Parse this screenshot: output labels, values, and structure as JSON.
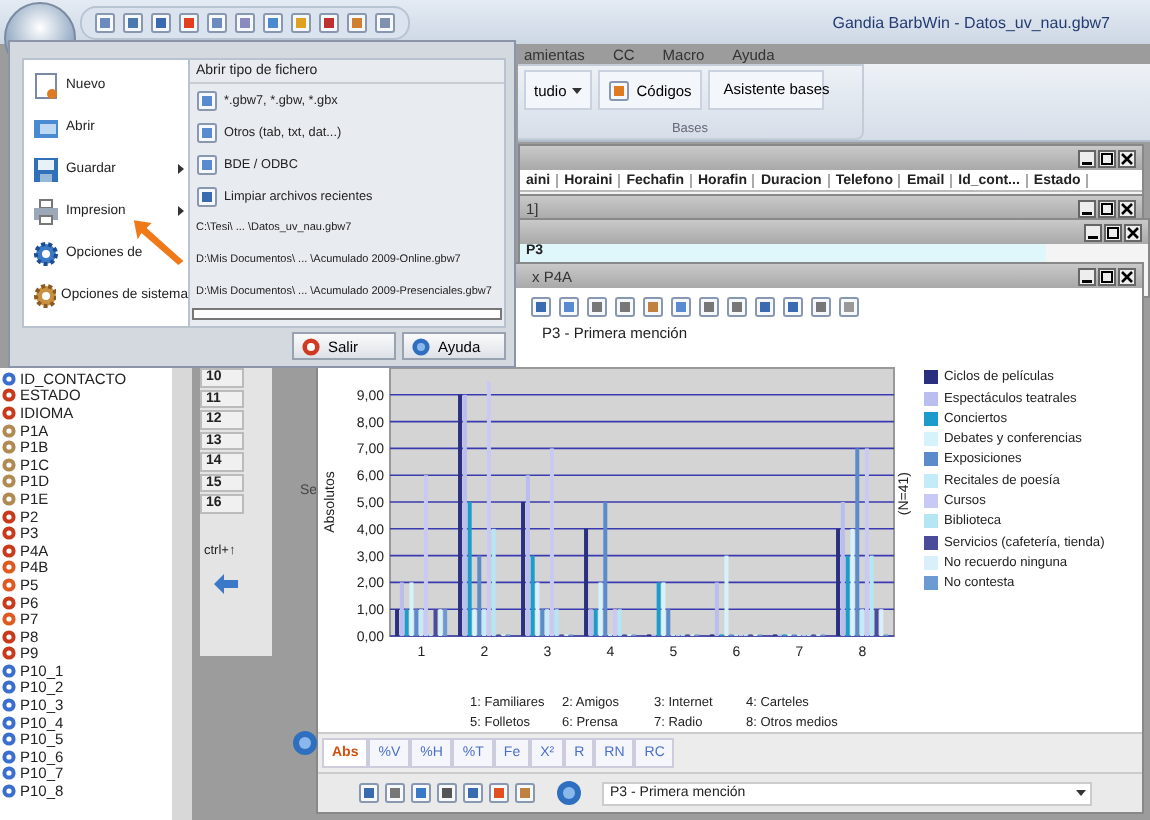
{
  "title_bar": {
    "title": "Gandia BarbWin - Datos_uv_nau.gbw7"
  },
  "menu_tabs": [
    {
      "label": "amientas",
      "selected": false
    },
    {
      "label": "CC",
      "selected": false
    },
    {
      "label": "Macro",
      "selected": false
    },
    {
      "label": "Ayuda",
      "selected": false
    }
  ],
  "ribbon": {
    "buttons": [
      {
        "label": "tudio",
        "kind": "dropdown"
      },
      {
        "label": "Códigos",
        "kind": "small"
      },
      {
        "label": "Asistente bases",
        "kind": "large"
      }
    ],
    "group_label": "Bases"
  },
  "variables": [
    {
      "name": "ID_CONTACTO",
      "kind": "numeric"
    },
    {
      "name": "ESTADO",
      "kind": "categorical"
    },
    {
      "name": "IDIOMA",
      "kind": "categorical"
    },
    {
      "name": "P1A",
      "kind": "alpha"
    },
    {
      "name": "P1B",
      "kind": "alpha"
    },
    {
      "name": "P1C",
      "kind": "alpha"
    },
    {
      "name": "P1D",
      "kind": "alpha"
    },
    {
      "name": "P1E",
      "kind": "alpha"
    },
    {
      "name": "P2",
      "kind": "categorical"
    },
    {
      "name": "P3",
      "kind": "categorical"
    },
    {
      "name": "P4A",
      "kind": "categorical"
    },
    {
      "name": "P4B",
      "kind": "multiple"
    },
    {
      "name": "P5",
      "kind": "multiple"
    },
    {
      "name": "P6",
      "kind": "categorical"
    },
    {
      "name": "P7",
      "kind": "multiple"
    },
    {
      "name": "P8",
      "kind": "categorical"
    },
    {
      "name": "P9",
      "kind": "categorical"
    },
    {
      "name": "P10_1",
      "kind": "numeric"
    },
    {
      "name": "P10_2",
      "kind": "numeric"
    },
    {
      "name": "P10_3",
      "kind": "numeric"
    },
    {
      "name": "P10_4",
      "kind": "numeric"
    },
    {
      "name": "P10_5",
      "kind": "numeric"
    },
    {
      "name": "P10_6",
      "kind": "numeric"
    },
    {
      "name": "P10_7",
      "kind": "numeric"
    },
    {
      "name": "P10_8",
      "kind": "numeric"
    }
  ],
  "row_panel": {
    "rows": [
      "10",
      "11",
      "12",
      "13",
      "14",
      "15",
      "16"
    ],
    "shortcut": "ctrl+↑",
    "cut_text": "Se"
  },
  "data_window": {
    "columns": [
      "aini",
      "Horaini",
      "Fechafin",
      "Horafin",
      "Duracion",
      "Telefono",
      "Email",
      "Id_cont...",
      "Estado"
    ]
  },
  "back_windows": [
    {
      "title": "1]"
    },
    {
      "title": "P3"
    }
  ],
  "chart_window": {
    "title": "x P4A",
    "chart_title": "P3 - Primera mención",
    "n_label": "(N=41)",
    "category_legend": [
      "1:  Familiares",
      "2:  Amigos",
      "3:  Internet",
      "4:  Carteles",
      "5:  Folletos",
      "6:  Prensa",
      "7:  Radio",
      "8:  Otros medios"
    ],
    "tabs": [
      {
        "label": "Abs",
        "selected": true
      },
      {
        "label": "%V",
        "selected": false
      },
      {
        "label": "%H",
        "selected": false
      },
      {
        "label": "%T",
        "selected": false
      },
      {
        "label": "Fe",
        "selected": false
      },
      {
        "label": "X²",
        "selected": false
      },
      {
        "label": "R",
        "selected": false
      },
      {
        "label": "RN",
        "selected": false
      },
      {
        "label": "RC",
        "selected": false
      }
    ],
    "selector": "P3 - Primera mención",
    "chart_data": {
      "type": "bar",
      "grid": true,
      "ylabel": "Absolutos",
      "categories": [
        "1",
        "2",
        "3",
        "4",
        "5",
        "6",
        "7",
        "8"
      ],
      "ylim": [
        0,
        10
      ],
      "yticks": [
        {
          "value": 0,
          "label": "0,00"
        },
        {
          "value": 1,
          "label": "1,00"
        },
        {
          "value": 2,
          "label": "2,00"
        },
        {
          "value": 3,
          "label": "3,00"
        },
        {
          "value": 4,
          "label": "4,00"
        },
        {
          "value": 5,
          "label": "5,00"
        },
        {
          "value": 6,
          "label": "6,00"
        },
        {
          "value": 7,
          "label": "7,00"
        },
        {
          "value": 8,
          "label": "8,00"
        },
        {
          "value": 9,
          "label": "9,00"
        }
      ],
      "series": [
        {
          "name": "Ciclos de películas",
          "color": "#2b2f80",
          "values": [
            1,
            9,
            5,
            4,
            0,
            0,
            0,
            4
          ]
        },
        {
          "name": "Espectáculos teatrales",
          "color": "#b9bdf0",
          "values": [
            2,
            9,
            6,
            1,
            0,
            2,
            0,
            5
          ]
        },
        {
          "name": "Conciertos",
          "color": "#1c9ccb",
          "values": [
            1,
            5,
            3,
            1,
            2,
            0,
            0,
            3
          ]
        },
        {
          "name": "Debates y conferencias",
          "color": "#d6f3fb",
          "values": [
            2,
            1,
            2,
            2,
            2,
            3,
            0,
            4
          ]
        },
        {
          "name": "Exposiciones",
          "color": "#5b8bcb",
          "values": [
            1,
            3,
            1,
            5,
            1,
            0,
            0,
            7
          ]
        },
        {
          "name": "Recitales de poesía",
          "color": "#c6ebf8",
          "values": [
            1,
            1,
            1,
            0,
            0,
            0,
            0,
            1
          ]
        },
        {
          "name": "Cursos",
          "color": "#c9c9f5",
          "values": [
            6,
            9.5,
            7,
            1,
            0,
            0,
            0,
            7
          ]
        },
        {
          "name": "Biblioteca",
          "color": "#b5e6f4",
          "values": [
            0,
            4,
            1,
            1,
            0,
            0,
            0,
            3
          ]
        },
        {
          "name": "Servicios (cafetería, tienda)",
          "color": "#4b4b9c",
          "values": [
            1,
            0,
            0,
            0,
            0,
            0,
            0,
            1
          ]
        },
        {
          "name": "No recuerdo ninguna",
          "color": "#d9f0fa",
          "values": [
            1,
            0,
            0,
            0,
            0,
            0,
            0,
            1
          ]
        },
        {
          "name": "No contesta",
          "color": "#6b9bd1",
          "values": [
            1,
            0,
            0,
            0,
            0,
            0,
            0,
            0
          ]
        }
      ]
    }
  },
  "app_menu": {
    "items": [
      {
        "label": "Nuevo",
        "submenu": false
      },
      {
        "label": "Abrir",
        "submenu": false
      },
      {
        "label": "Guardar",
        "submenu": true
      },
      {
        "label": "Impresion",
        "submenu": true
      },
      {
        "label": "Opciones de",
        "submenu": false
      },
      {
        "label": "Opciones de sistema",
        "submenu": false
      }
    ],
    "header": "Abrir tipo de fichero",
    "open_items": [
      "*.gbw7, *.gbw, *.gbx",
      "Otros (tab, txt, dat...)",
      "BDE / ODBC",
      "Limpiar archivos recientes"
    ],
    "recent_files": [
      "C:\\Tesi\\ ... \\Datos_uv_nau.gbw7",
      "D:\\Mis Documentos\\ ... \\Acumulado 2009-Online.gbw7",
      "D:\\Mis Documentos\\ ... \\Acumulado 2009-Presenciales.gbw7"
    ],
    "buttons": [
      "Salir",
      "Ayuda"
    ]
  }
}
